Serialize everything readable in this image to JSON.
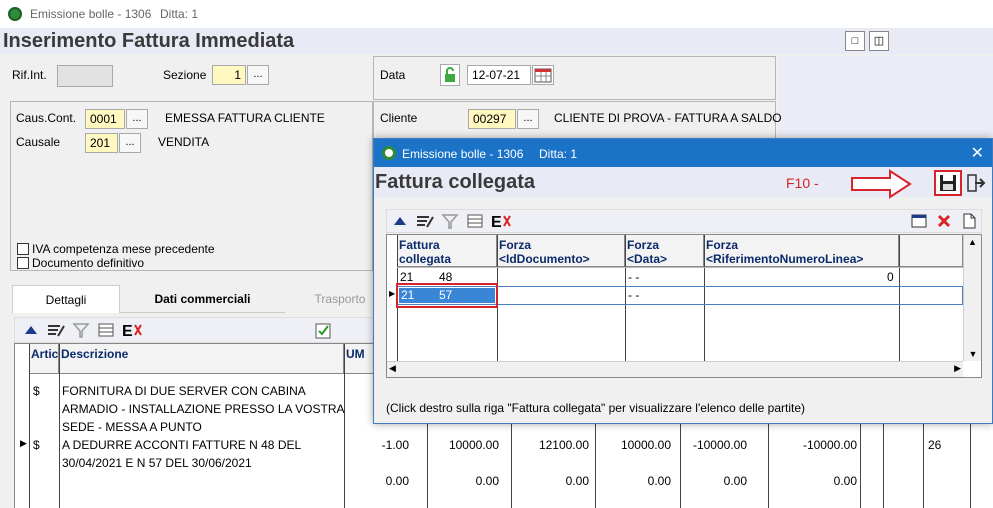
{
  "window": {
    "title": "Emissione bolle - 1306",
    "ditta": "Ditta: 1"
  },
  "heading": "Inserimento Fattura Immediata",
  "header": {
    "rif_int_label": "Rif.Int.",
    "sezione_label": "Sezione",
    "sezione_value": "1",
    "data_label": "Data",
    "data_value": "12-07-21",
    "caus_cont_label": "Caus.Cont.",
    "caus_cont_value": "0001",
    "caus_cont_desc": "EMESSA FATTURA CLIENTE",
    "causale_label": "Causale",
    "causale_value": "201",
    "causale_desc": "VENDITA",
    "cliente_label": "Cliente",
    "cliente_value": "00297",
    "cliente_desc": "CLIENTE DI PROVA - FATTURA A SALDO",
    "iva_checkbox": "IVA competenza mese precedente",
    "doc_checkbox": "Documento definitivo",
    "dots": "..."
  },
  "tabs": [
    {
      "label": "Dettagli"
    },
    {
      "label": "Dati commerciali"
    },
    {
      "label": "Trasporto"
    }
  ],
  "grid": {
    "col_artic": "Artic",
    "col_descr": "Descrizione",
    "col_um": "UM",
    "rows": [
      {
        "artic": "$",
        "lines": [
          "FORNITURA DI DUE SERVER CON CABINA",
          "ARMADIO - INSTALLAZIONE PRESSO LA VOSTRA",
          "SEDE - MESSA A PUNTO"
        ]
      },
      {
        "artic": "$",
        "lines": [
          "A DEDURRE ACCONTI FATTURE N 48 DEL",
          "30/04/2021 E N 57 DEL 30/06/2021"
        ],
        "qty": "-1.00",
        "v1": "10000.00",
        "v2": "12100.00",
        "v3": "10000.00",
        "v4": "-10000.00",
        "v5": "-10000.00",
        "v6": "26"
      },
      {
        "qty": "0.00",
        "v1": "0.00",
        "v2": "0.00",
        "v3": "0.00",
        "v4": "0.00",
        "v5": "0.00"
      }
    ]
  },
  "modal": {
    "title": "Emissione bolle - 1306",
    "ditta": "Ditta: 1",
    "close": "✕",
    "heading": "Fattura collegata",
    "f10": "F10 -",
    "columns": [
      "Fattura collegata",
      "Forza <IdDocumento>",
      "Forza <Data>",
      "Forza <RiferimentoNumeroLinea>"
    ],
    "rows": [
      {
        "anno": "21",
        "num": "48",
        "data": "- -",
        "linea": "0"
      },
      {
        "anno": "21",
        "num": "57",
        "data": "- -",
        "linea": ""
      }
    ],
    "footer": "(Click destro sulla riga \"Fattura collegata\" per visualizzare l'elenco delle partite)"
  },
  "colors": {
    "accent": "#1a73c6",
    "annotation": "#d6242c",
    "field_bg": "#fff8c0"
  }
}
